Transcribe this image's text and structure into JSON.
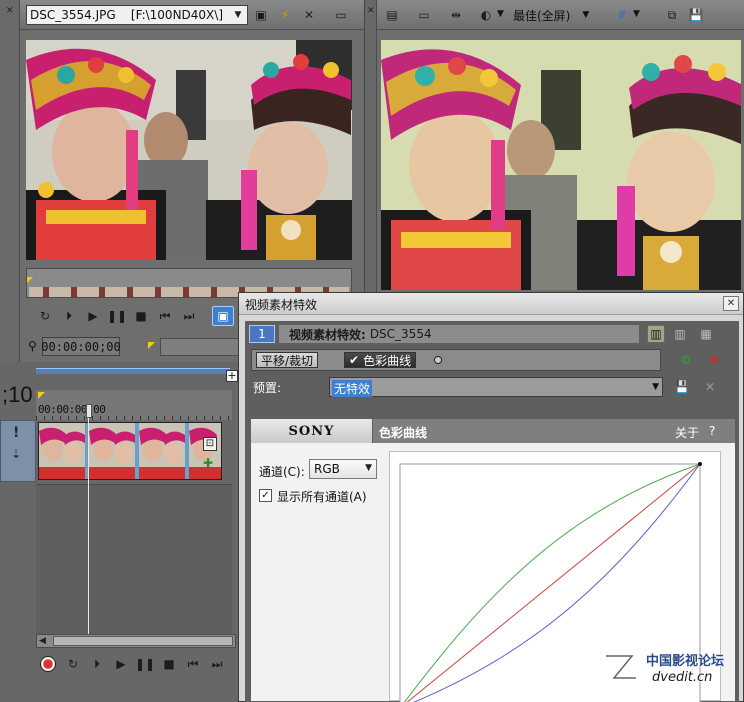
{
  "trimmer": {
    "clip_selector": "DSC_3554.JPG    [F:\\100ND40X\\]",
    "timecode": "00:00:00;00"
  },
  "preview": {
    "quality_label": "最佳(全屏)"
  },
  "timeline": {
    "timecode_fragment": ";10",
    "ruler_time": "00:00:00;00",
    "track_marker": "!"
  },
  "dialog": {
    "title": "视频素材特效",
    "track_number": "1",
    "fx_header_label": "视频素材特效:",
    "fx_header_clip": "DSC_3554",
    "chain": [
      "平移/裁切",
      "色彩曲线"
    ],
    "preset_label": "预置:",
    "preset_value": "无特效",
    "plugin": {
      "brand": "SONY",
      "name": "色彩曲线",
      "about": "关于",
      "help": "?",
      "channel_label": "通道(C):",
      "channel_value": "RGB",
      "show_all_label": "显示所有通道(A)",
      "show_all_checked": true
    }
  },
  "watermark": {
    "line1": "中国影视论坛",
    "line2": "dvedit.cn"
  },
  "colors": {
    "accent": "#3f7fd0",
    "curve_green": "#4caa4c",
    "curve_red": "#d94040",
    "curve_blue": "#5a5ad8"
  }
}
